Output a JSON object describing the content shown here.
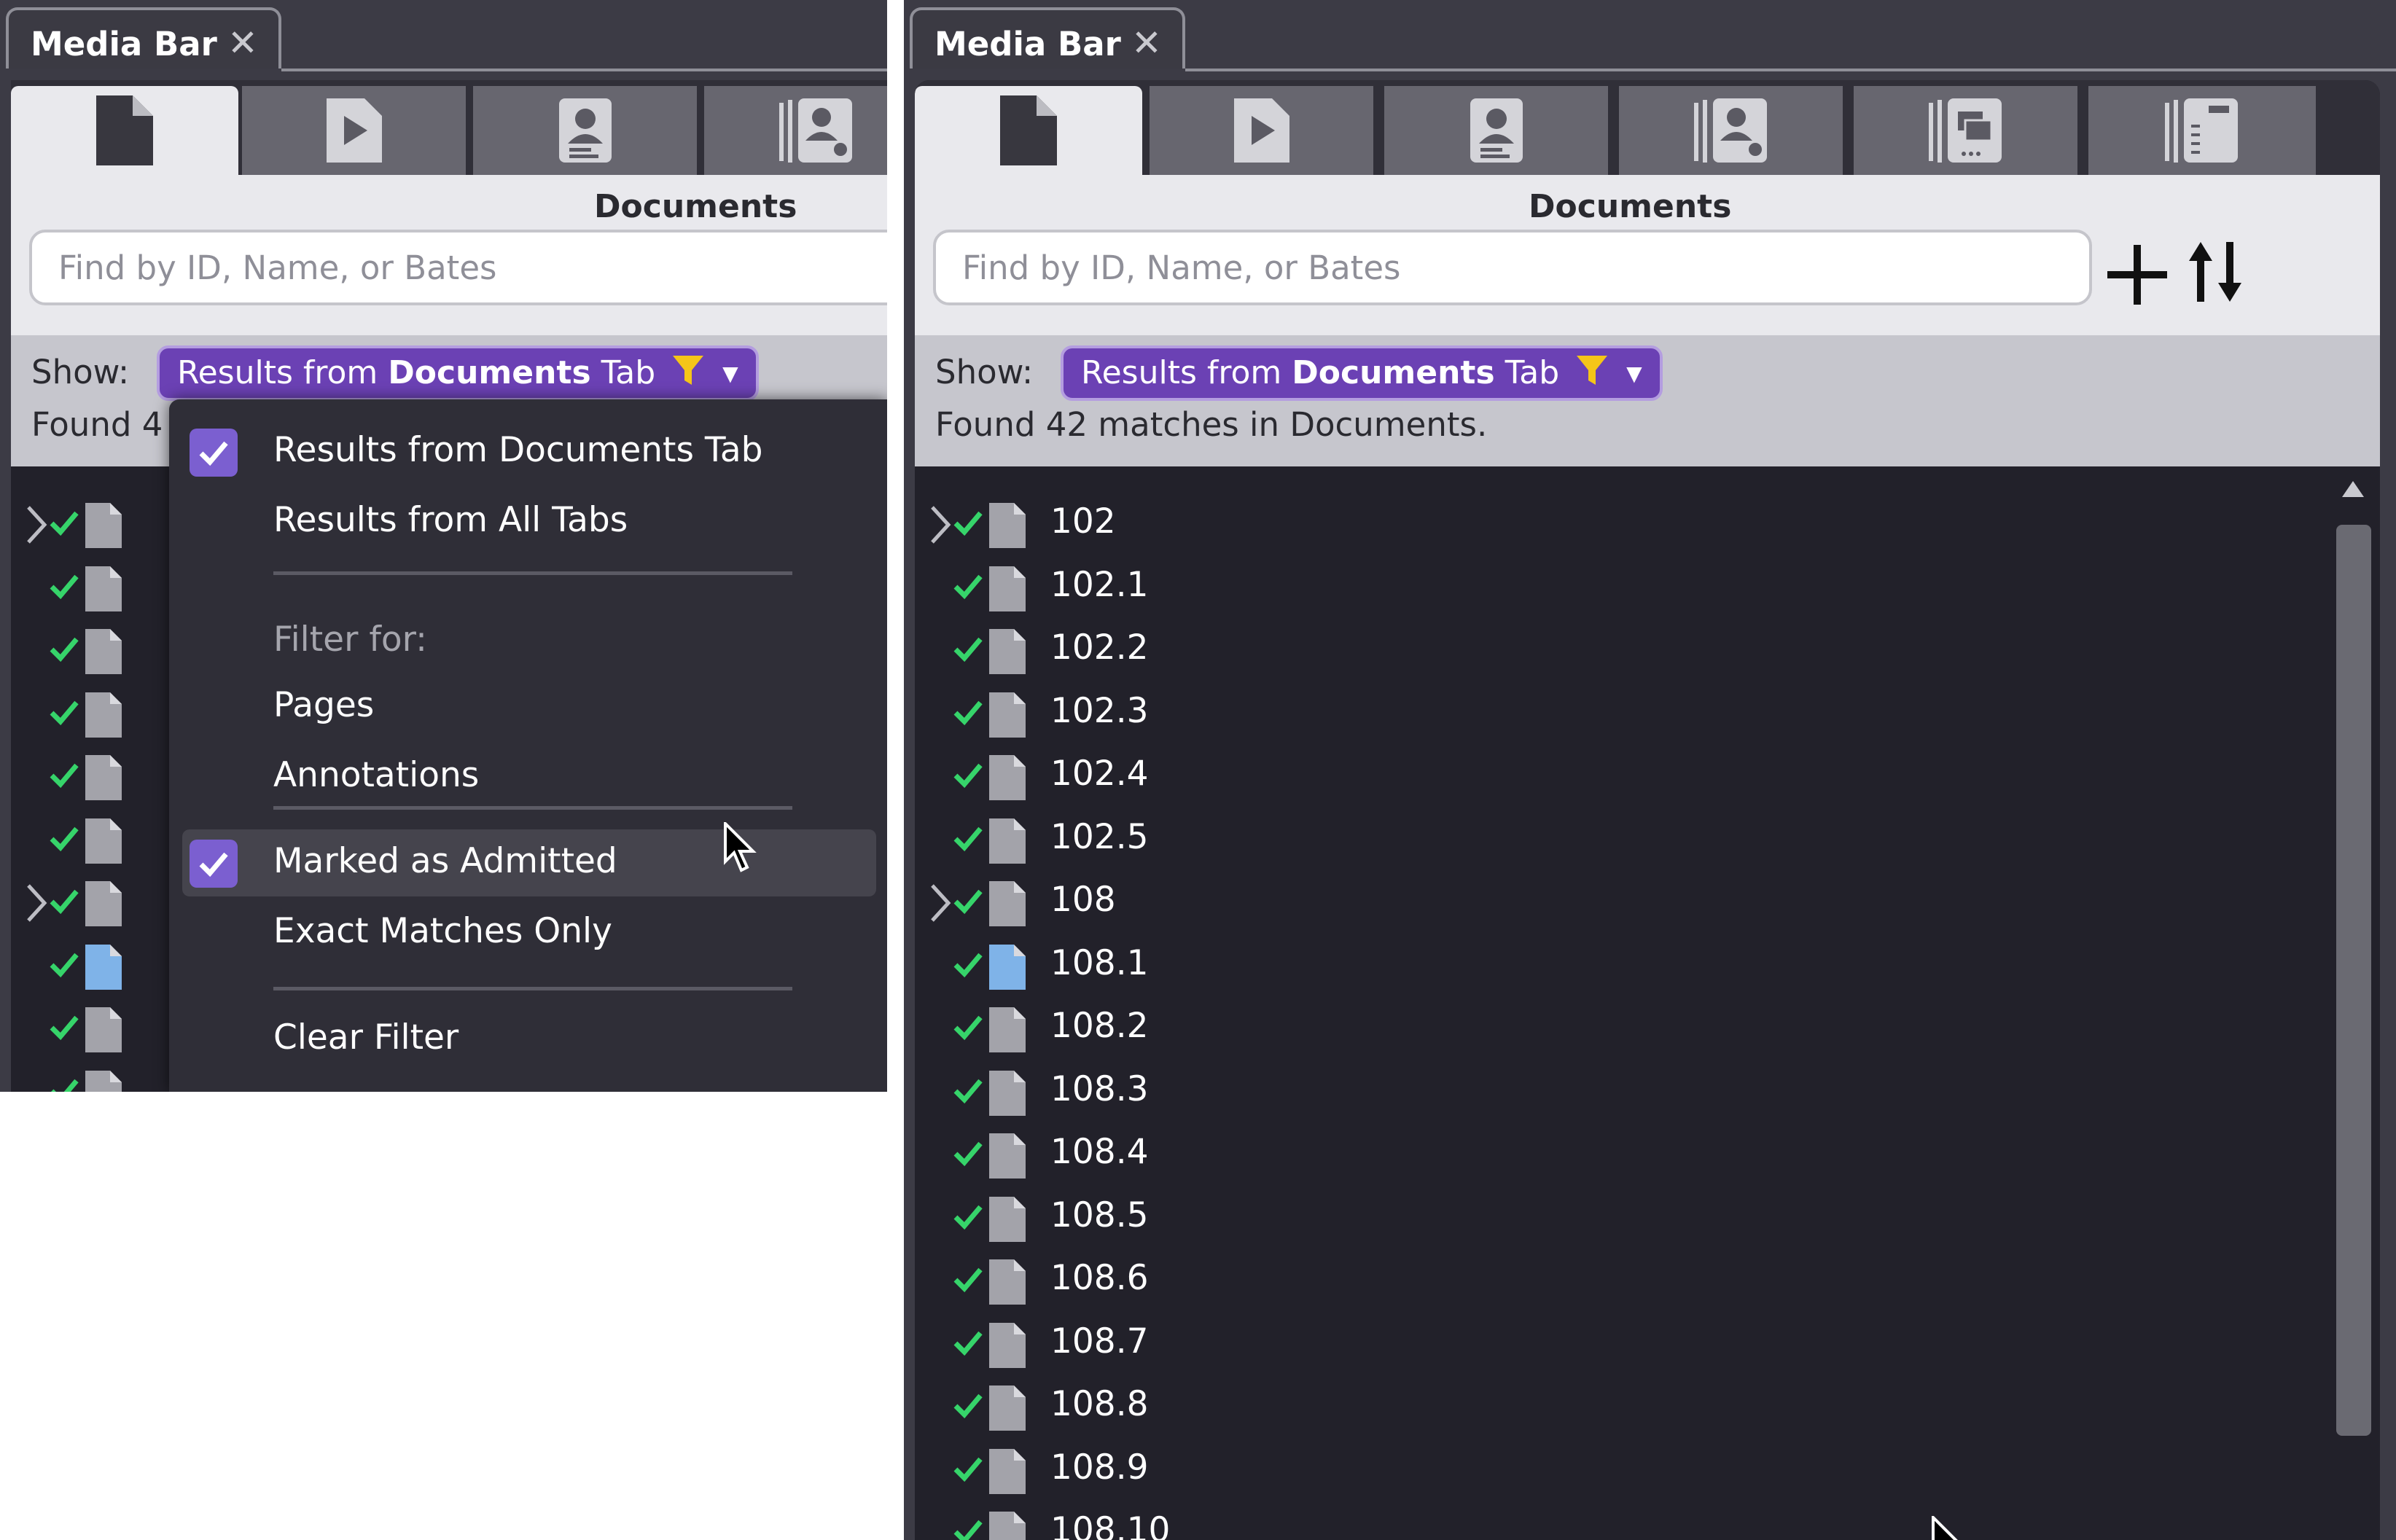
{
  "left_panel": {
    "title": "Media Bar",
    "close_glyph": "✕",
    "header_title": "Documents",
    "search": {
      "placeholder": "Find by ID, Name, or Bates"
    },
    "show_label": "Show:",
    "show_filter": {
      "prefix": "Results from ",
      "bold": "Documents",
      "suffix": " Tab"
    },
    "found_text": "Found 4",
    "dropdown": {
      "items": [
        {
          "label": "Results from Documents Tab",
          "checked": true
        },
        {
          "label": "Results from All Tabs",
          "checked": false
        },
        {
          "label": "Filter for:",
          "header": true
        },
        {
          "label": "Pages",
          "checked": false
        },
        {
          "label": "Annotations",
          "checked": false
        },
        {
          "label": "Marked as Admitted",
          "checked": true,
          "highlighted": true
        },
        {
          "label": "Exact Matches Only",
          "checked": false
        },
        {
          "label": "Clear Filter",
          "checked": false
        }
      ]
    }
  },
  "right_panel": {
    "title": "Media Bar",
    "close_glyph": "✕",
    "header_title": "Documents",
    "search": {
      "placeholder": "Find by ID, Name, or Bates"
    },
    "add_glyph": "+",
    "sort_glyph": "⇅",
    "show_label": "Show:",
    "show_filter": {
      "prefix": "Results from ",
      "bold": "Documents",
      "suffix": " Tab"
    },
    "found_text": "Found 42 matches in Documents.",
    "rows": [
      {
        "label": "102",
        "expandable": true,
        "color": "#a3a3aa"
      },
      {
        "label": "102.1",
        "color": "#a3a3aa"
      },
      {
        "label": "102.2",
        "color": "#a3a3aa"
      },
      {
        "label": "102.3",
        "color": "#a3a3aa"
      },
      {
        "label": "102.4",
        "color": "#a3a3aa"
      },
      {
        "label": "102.5",
        "color": "#a3a3aa"
      },
      {
        "label": "108",
        "expandable": true,
        "color": "#a3a3aa"
      },
      {
        "label": "108.1",
        "color": "#7fb3e8"
      },
      {
        "label": "108.2",
        "color": "#a3a3aa"
      },
      {
        "label": "108.3",
        "color": "#a3a3aa"
      },
      {
        "label": "108.4",
        "color": "#a3a3aa"
      },
      {
        "label": "108.5",
        "color": "#a3a3aa"
      },
      {
        "label": "108.6",
        "color": "#a3a3aa"
      },
      {
        "label": "108.7",
        "color": "#a3a3aa"
      },
      {
        "label": "108.8",
        "color": "#a3a3aa"
      },
      {
        "label": "108.9",
        "color": "#a3a3aa"
      },
      {
        "label": "108.10",
        "color": "#a3a3aa"
      }
    ]
  },
  "colors": {
    "accent_purple": "#6b41b4",
    "check_green": "#36d46a",
    "funnel_yellow": "#f5c518",
    "doc_grey": "#a3a3aa",
    "doc_blue": "#7fb3e8"
  },
  "tab_icons": [
    "document-icon",
    "play-media-icon",
    "witness-card-icon",
    "deposition-icon",
    "exhibit-stack-icon",
    "transcript-icon"
  ]
}
